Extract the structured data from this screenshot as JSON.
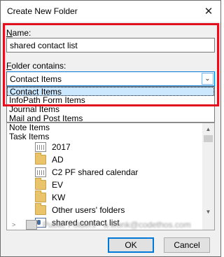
{
  "window": {
    "title": "Create New Folder"
  },
  "form": {
    "name_label_ul": "N",
    "name_label_rest": "ame:",
    "name_value": "shared contact list",
    "contains_label_ul": "F",
    "contains_label_rest": "older contains:",
    "contains_selected": "Contact Items"
  },
  "dropdown": {
    "options": [
      "Contact Items",
      "InfoPath Form Items",
      "Journal Items",
      "Mail and Post Items",
      "Note Items",
      "Task Items"
    ]
  },
  "tree": {
    "items": [
      {
        "label": "2017",
        "icon": "calendar-icon"
      },
      {
        "label": "AD",
        "icon": "folder-icon"
      },
      {
        "label": "C2 PF shared calendar",
        "icon": "calendar-icon"
      },
      {
        "label": "EV",
        "icon": "folder-icon"
      },
      {
        "label": "KW",
        "icon": "folder-icon"
      },
      {
        "label": "Other users' folders",
        "icon": "folder-icon"
      },
      {
        "label": "shared contact list",
        "icon": "contact-icon"
      }
    ],
    "public_folders_label": "Public Folders - a.wonk@codethos.com"
  },
  "buttons": {
    "ok": "OK",
    "cancel": "Cancel"
  },
  "colors": {
    "highlight": "#e0101f",
    "selection": "#cce8ff",
    "accent": "#0078d7"
  }
}
